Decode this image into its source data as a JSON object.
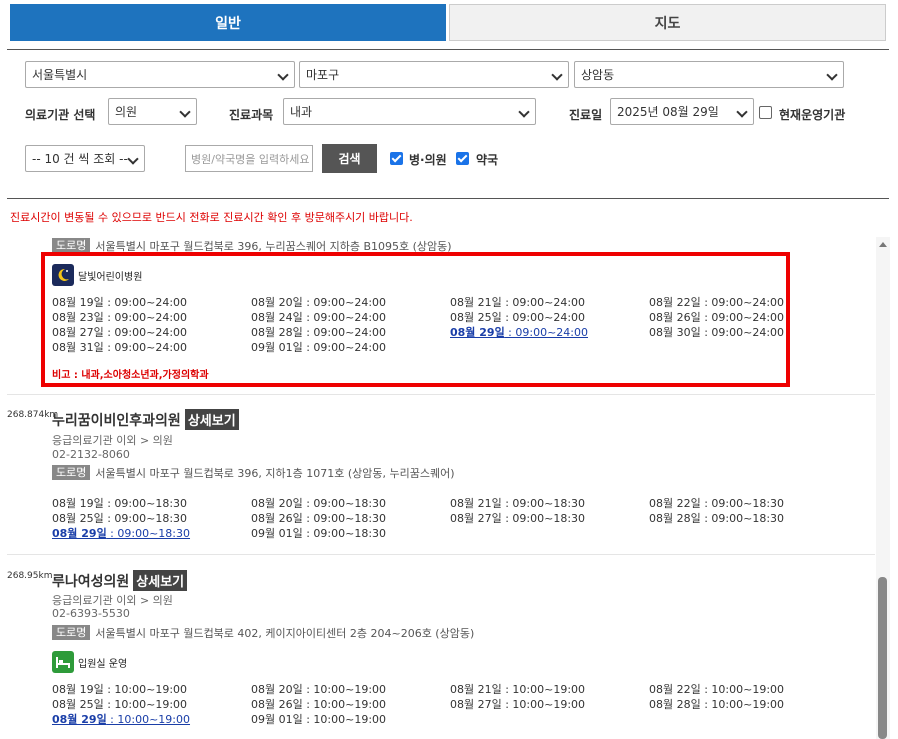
{
  "tabs": {
    "general": "일반",
    "map": "지도"
  },
  "filters": {
    "city": "서울특별시",
    "district": "마포구",
    "dong": "상암동",
    "institution_label": "의료기관 선택",
    "institution_value": "의원",
    "department_label": "진료과목",
    "department_value": "내과",
    "date_label": "진료일",
    "date_value": "2025년 08월 29일",
    "open_now_label": "현재운영기관",
    "page_size": "-- 10 건 씩 조회 --",
    "search_placeholder": "병원/약국명을 입력하세요",
    "search_button": "검색",
    "hospital_label": "병·의원",
    "pharmacy_label": "약국"
  },
  "warning": "진료시간이 변동될 수 있으므로 반드시 전화로 진료시간 확인 후 방문해주시기 바랍니다.",
  "entry1": {
    "road_tag": "도로명",
    "address": "서울특별시 마포구 월드컵북로 396, 누리꿈스퀘어 지하층 B1095호 (상암동)",
    "feature": "달빛어린이병원",
    "schedule": [
      [
        "08월 19일 : 09:00~24:00",
        "08월 20일 : 09:00~24:00",
        "08월 21일 : 09:00~24:00",
        "08월 22일 : 09:00~24:00"
      ],
      [
        "08월 23일 : 09:00~24:00",
        "08월 24일 : 09:00~24:00",
        "08월 25일 : 09:00~24:00",
        "08월 26일 : 09:00~24:00"
      ],
      [
        "08월 27일 : 09:00~24:00",
        "08월 28일 : 09:00~24:00",
        "08월 29일 : 09:00~24:00",
        "08월 30일 : 09:00~24:00"
      ],
      [
        "08월 31일 : 09:00~24:00",
        "09월 01일 : 09:00~24:00",
        "",
        ""
      ]
    ],
    "note": "비고 : 내과,소아청소년과,가정의학과"
  },
  "entry2": {
    "distance": "268.874km",
    "name": "누리꿈이비인후과의원",
    "detail": "상세보기",
    "category": "응급의료기관 이외 > 의원",
    "phone": "02-2132-8060",
    "road_tag": "도로명",
    "address": "서울특별시 마포구 월드컵북로 396, 지하1층 1071호 (상암동, 누리꿈스퀘어)",
    "schedule": [
      [
        "08월 19일 : 09:00~18:30",
        "08월 20일 : 09:00~18:30",
        "08월 21일 : 09:00~18:30",
        "08월 22일 : 09:00~18:30"
      ],
      [
        "08월 25일 : 09:00~18:30",
        "08월 26일 : 09:00~18:30",
        "08월 27일 : 09:00~18:30",
        "08월 28일 : 09:00~18:30"
      ],
      [
        "08월 29일 : 09:00~18:30",
        "09월 01일 : 09:00~18:30",
        "",
        ""
      ]
    ]
  },
  "entry3": {
    "distance": "268.95km",
    "name": "루나여성의원",
    "detail": "상세보기",
    "category": "응급의료기관 이외 > 의원",
    "phone": "02-6393-5530",
    "road_tag": "도로명",
    "address": "서울특별시 마포구 월드컵북로 402, 케이지아이티센터 2층 204~206호 (상암동)",
    "feature": "입원실 운영",
    "schedule": [
      [
        "08월 19일 : 10:00~19:00",
        "08월 20일 : 10:00~19:00",
        "08월 21일 : 10:00~19:00",
        "08월 22일 : 10:00~19:00"
      ],
      [
        "08월 25일 : 10:00~19:00",
        "08월 26일 : 10:00~19:00",
        "08월 27일 : 10:00~19:00",
        "08월 28일 : 10:00~19:00"
      ],
      [
        "08월 29일 : 10:00~19:00",
        "09월 01일 : 10:00~19:00",
        "",
        ""
      ]
    ]
  },
  "today_prefix": "08월 29일",
  "colors": {
    "tab_active": "#1e73be",
    "highlight": "#e00000",
    "moon_icon_bg": "#1b2a5b",
    "bed_icon_bg": "#2e9b3a"
  }
}
